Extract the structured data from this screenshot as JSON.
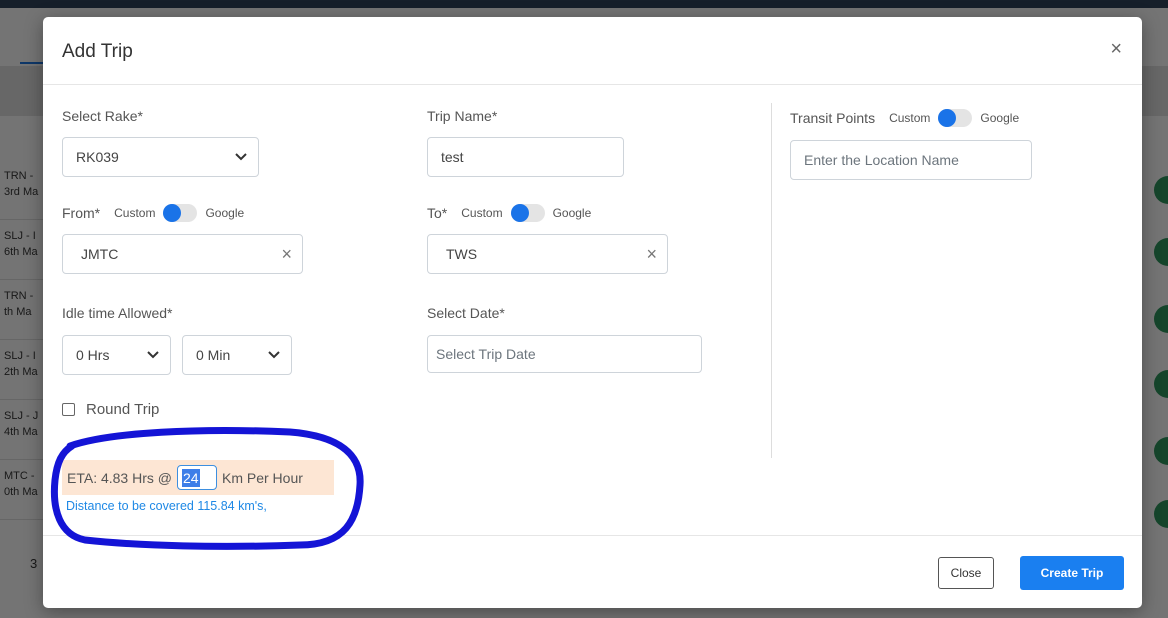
{
  "background": {
    "rows": [
      {
        "line1": "TRN -",
        "line2": "3rd Ma"
      },
      {
        "line1": "SLJ - I",
        "line2": "6th Ma"
      },
      {
        "line1": "TRN -",
        "line2": "th Ma"
      },
      {
        "line1": "SLJ - I",
        "line2": "2th Ma"
      },
      {
        "line1": "SLJ - J",
        "line2": "4th Ma"
      },
      {
        "line1": "MTC -",
        "line2": "0th Ma"
      }
    ],
    "pager": "3"
  },
  "modal": {
    "title": "Add Trip",
    "close_icon": "×"
  },
  "form": {
    "rake_label": "Select Rake*",
    "rake_value": "RK039",
    "trip_name_label": "Trip Name*",
    "trip_name_value": "test",
    "transit_label": "Transit Points",
    "transit_custom": "Custom",
    "transit_google": "Google",
    "transit_placeholder": "Enter the Location Name",
    "from_label": "From*",
    "from_custom": "Custom",
    "from_google": "Google",
    "from_value": "JMTC",
    "to_label": "To*",
    "to_custom": "Custom",
    "to_google": "Google",
    "to_value": "TWS",
    "clear_icon": "×",
    "idle_label": "Idle time Allowed*",
    "idle_hrs": "0 Hrs",
    "idle_min": "0 Min",
    "date_label": "Select Date*",
    "date_placeholder": "Select Trip Date",
    "round_trip_label": "Round Trip"
  },
  "eta": {
    "prefix": "ETA: 4.83 Hrs @",
    "speed": "24",
    "suffix": "Km Per Hour",
    "distance": "Distance to be covered 115.84 km's,"
  },
  "footer": {
    "close_label": "Close",
    "create_label": "Create Trip"
  },
  "colors": {
    "primary": "#1a7ff0",
    "annotation": "#1414d6",
    "eta_bg": "#fde6d4"
  }
}
